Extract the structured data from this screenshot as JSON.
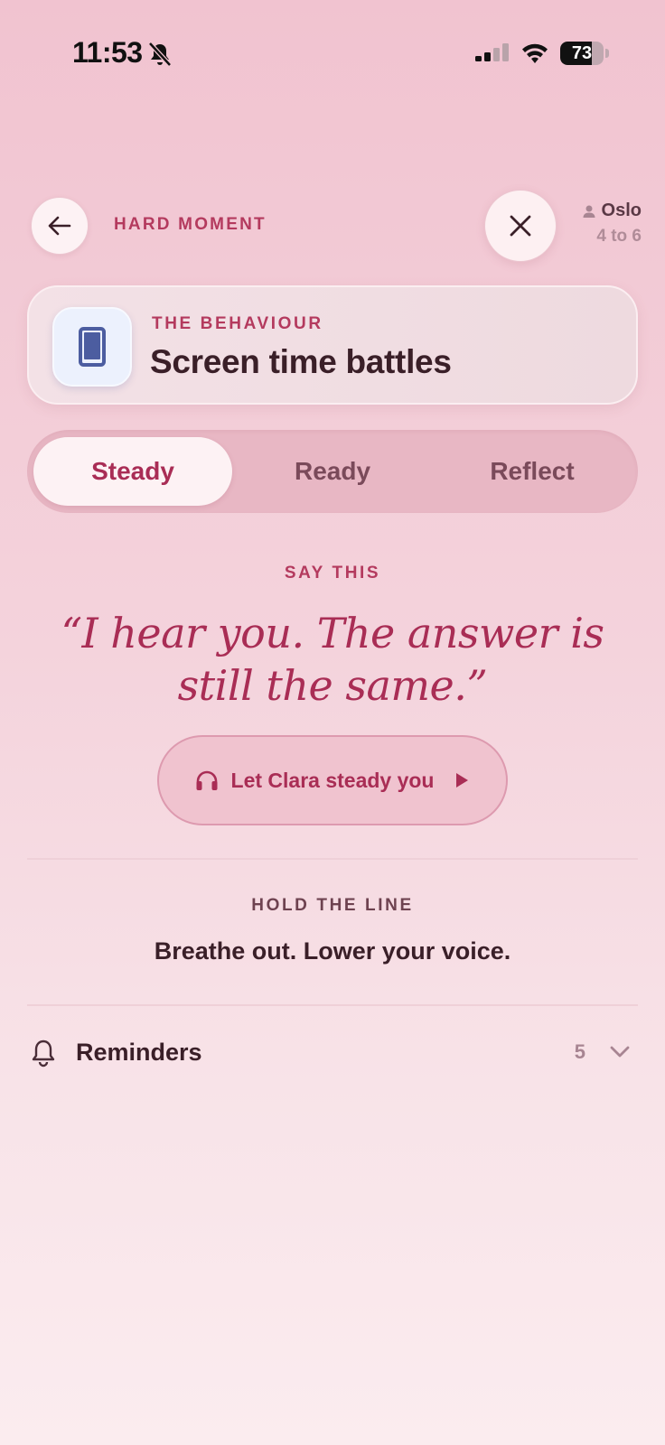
{
  "status_bar": {
    "time": "11:53",
    "battery": "73",
    "battery_level": 0.73,
    "icons": [
      "bell-slash-icon",
      "cellular-signal-icon",
      "wifi-icon",
      "battery-icon"
    ]
  },
  "header": {
    "title": "HARD MOMENT",
    "back_icon": "arrow-left-icon",
    "close_icon": "close-icon",
    "profile": {
      "icon": "person-icon",
      "name": "Oslo",
      "age": "4 to 6"
    }
  },
  "behaviour": {
    "label": "THE BEHAVIOUR",
    "title": "Screen time battles",
    "icon": "phone-icon"
  },
  "tabs": [
    {
      "label": "Steady",
      "active": true
    },
    {
      "label": "Ready",
      "active": false
    },
    {
      "label": "Reflect",
      "active": false
    }
  ],
  "say_this": {
    "label": "SAY THIS",
    "quote": "“I hear you. The answer is still the same.”",
    "audio_button": {
      "label": "Let Clara steady you",
      "icon": "headphones-icon",
      "play_icon": "play-icon"
    }
  },
  "hold_the_line": {
    "label": "HOLD THE LINE",
    "text": "Breathe out. Lower your voice."
  },
  "reminders": {
    "label": "Reminders",
    "count": "5",
    "icon": "bell-icon",
    "chevron": "chevron-down-icon"
  },
  "colors": {
    "accent": "#a92d55",
    "background_top": "#f1c3d0",
    "background_bottom": "#fbecef",
    "text_primary": "#3a1f28"
  }
}
